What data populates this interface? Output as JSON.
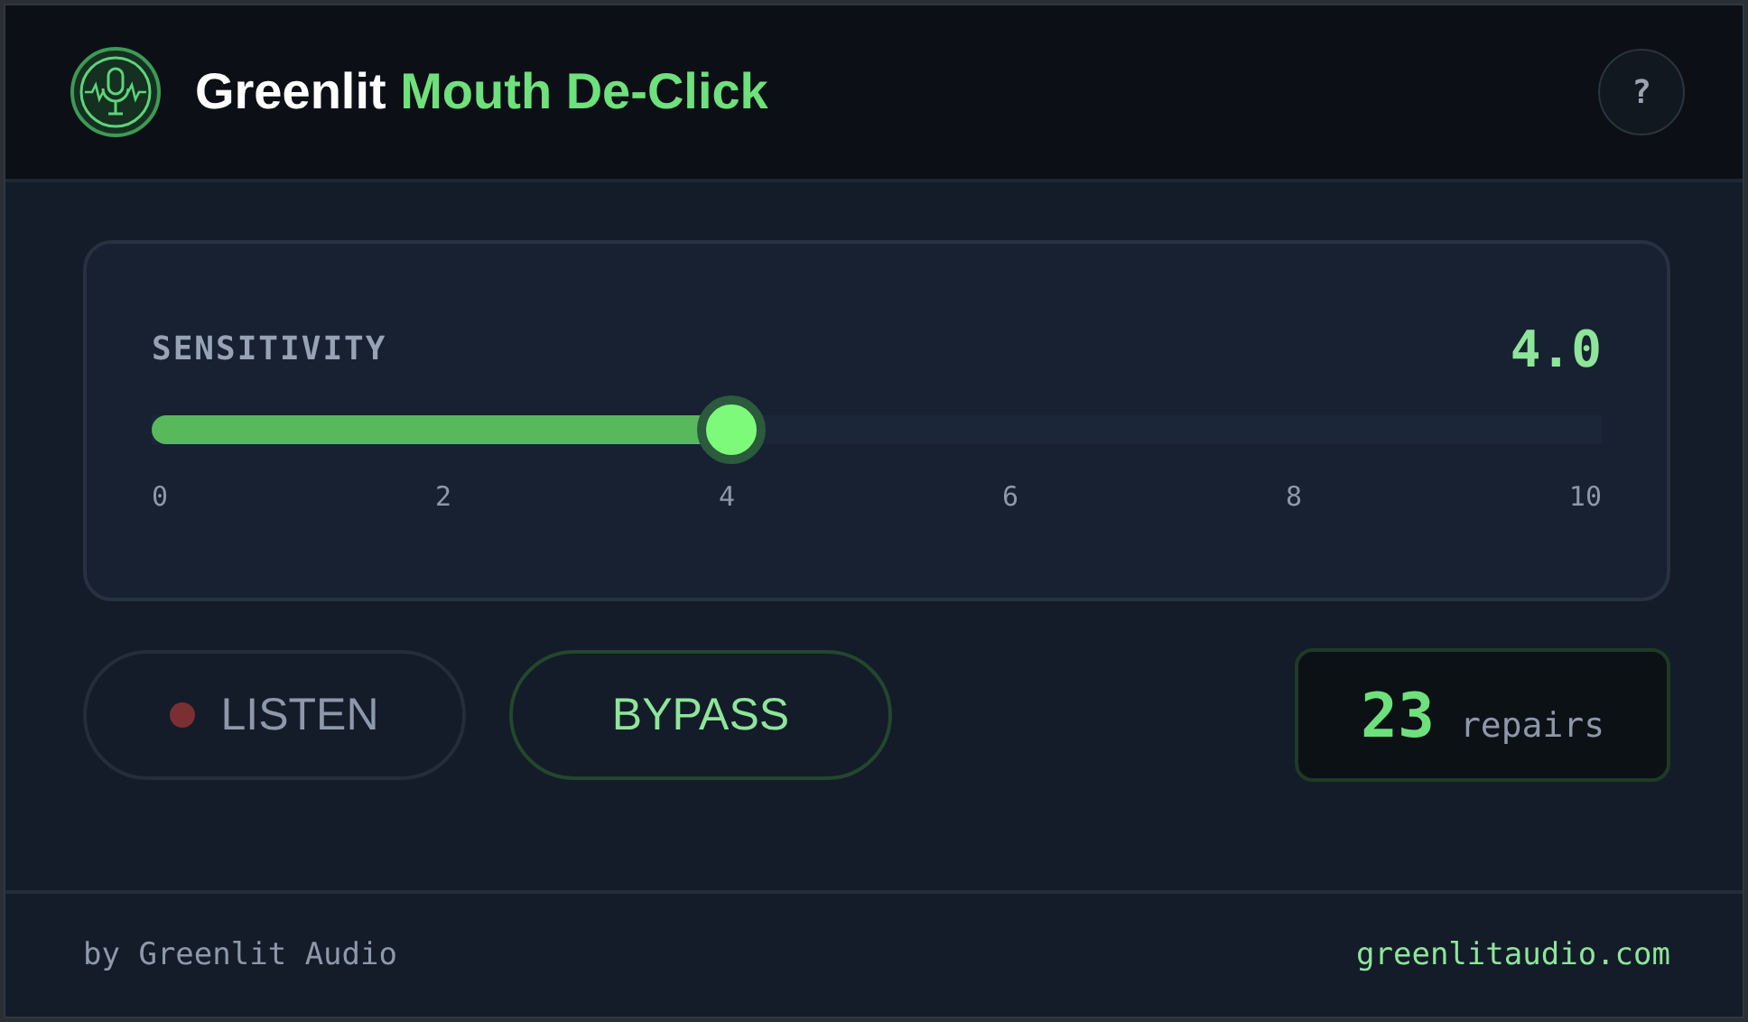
{
  "header": {
    "title": "Greenlit",
    "title_accent": "Mouth De-Click",
    "help": "?"
  },
  "slider": {
    "label": "SENSITIVITY",
    "reading": "4.0",
    "level": 0.4,
    "ticks": [
      "0",
      "2",
      "4",
      "6",
      "8",
      "10"
    ]
  },
  "buttons": [
    {
      "kind": "listen",
      "label": "LISTEN",
      "on": false
    },
    {
      "kind": "bypass",
      "label": "BYPASS",
      "on": false
    }
  ],
  "counter": {
    "value": "23",
    "unit": "repairs"
  },
  "footer": {
    "credit": "by Greenlit Audio",
    "link": "greenlitaudio.com"
  }
}
